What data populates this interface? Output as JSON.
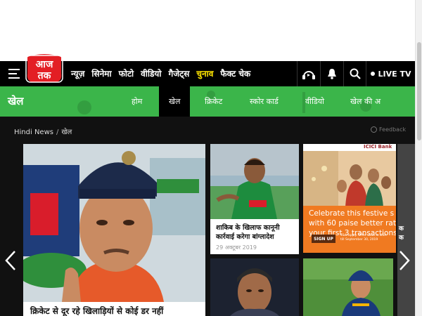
{
  "header": {
    "logo_text_top": "आज",
    "logo_text_bottom": "तक",
    "nav": [
      {
        "label": "न्यूज़",
        "highlight": false
      },
      {
        "label": "सिनेमा",
        "highlight": false
      },
      {
        "label": "फोटो",
        "highlight": false
      },
      {
        "label": "वीडियो",
        "highlight": false
      },
      {
        "label": "गैजेट्स",
        "highlight": false
      },
      {
        "label": "चुनाव",
        "highlight": true
      },
      {
        "label": "फैक्ट चेक",
        "highlight": false
      }
    ],
    "live_label": "LIVE TV",
    "icons": [
      "audio-icon",
      "bell-icon",
      "search-icon"
    ]
  },
  "section": {
    "title": "खेल",
    "tabs": [
      {
        "label": "होम",
        "active": false
      },
      {
        "label": "खेल",
        "active": true
      },
      {
        "label": "क्रिकेट",
        "active": false
      },
      {
        "label": "स्कोर कार्ड",
        "active": false
      },
      {
        "label": "वीडियो",
        "active": false
      },
      {
        "label": "खेल की अ",
        "active": false
      }
    ]
  },
  "breadcrumb": {
    "home": "Hindi News",
    "separator": "/",
    "current": "खेल"
  },
  "feedback": "Feedback",
  "cards": {
    "big": {
      "caption": "क्रिकेट से दूर रहे खिलाड़ियों से कोई डर नहीं"
    },
    "small1": {
      "title": "शाकिब के खिलाफ कानूनी कार्रवाई करेगा बांग्लादेश",
      "date": "29 अक्टूबर 2019"
    }
  },
  "ad": {
    "brand": "ICICI Bank",
    "line1": "Celebrate this festive s",
    "line2": "with 60 paise better rat",
    "line3": "your first 3 transactions",
    "signup": "SIGN UP",
    "fine": "T&C apply. Offer valid in USA till September 30, 2019"
  },
  "peek": {
    "line1": "क",
    "line2": "क"
  },
  "colors": {
    "brand_red": "#e31e24",
    "section_green": "#3bb54a",
    "highlight_yellow": "#ffe400",
    "ad_orange": "#f07a21"
  }
}
